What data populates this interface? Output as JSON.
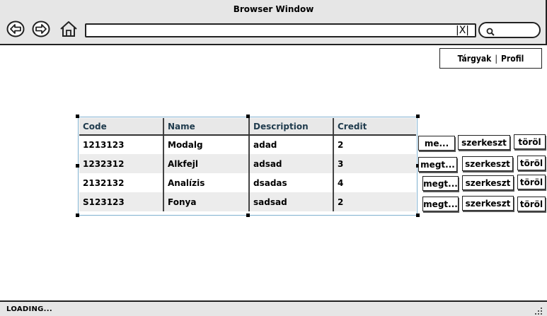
{
  "window": {
    "title": "Browser Window",
    "address_value": "",
    "clear_glyph": "|X|",
    "search_value": ""
  },
  "icons": {
    "back": "back-icon",
    "forward": "forward-icon",
    "home": "home-icon",
    "clear": "clear-icon",
    "search": "search-icon",
    "resize": "resize-grip-icon"
  },
  "nav_menu": {
    "items": [
      {
        "label": "Tárgyak"
      },
      {
        "label": "Profil"
      }
    ],
    "separator": "|"
  },
  "table": {
    "columns": [
      "Code",
      "Name",
      "Description",
      "Credit"
    ],
    "rows": [
      [
        "1213123",
        "Modalg",
        "adad",
        "2"
      ],
      [
        "1232312",
        "Alkfejl",
        "adsad",
        "3"
      ],
      [
        "2132132",
        "Analízis",
        "dsadas",
        "4"
      ],
      [
        "S123123",
        "Fonya",
        "sadsad",
        "2"
      ]
    ]
  },
  "row_actions": [
    {
      "view": "me...",
      "edit": "szerkeszt",
      "delete": "töröl"
    },
    {
      "view": "megt...",
      "edit": "szerkeszt",
      "delete": "töröl"
    },
    {
      "view": "megt...",
      "edit": "szerkeszt",
      "delete": "töröl"
    },
    {
      "view": "megt...",
      "edit": "szerkeszt",
      "delete": "töröl"
    }
  ],
  "status": {
    "text": "LOADING..."
  },
  "colors": {
    "chrome": "#e6e6e6",
    "table_header_text": "#1f3b4d",
    "selection_outline": "#7fb0cf"
  }
}
